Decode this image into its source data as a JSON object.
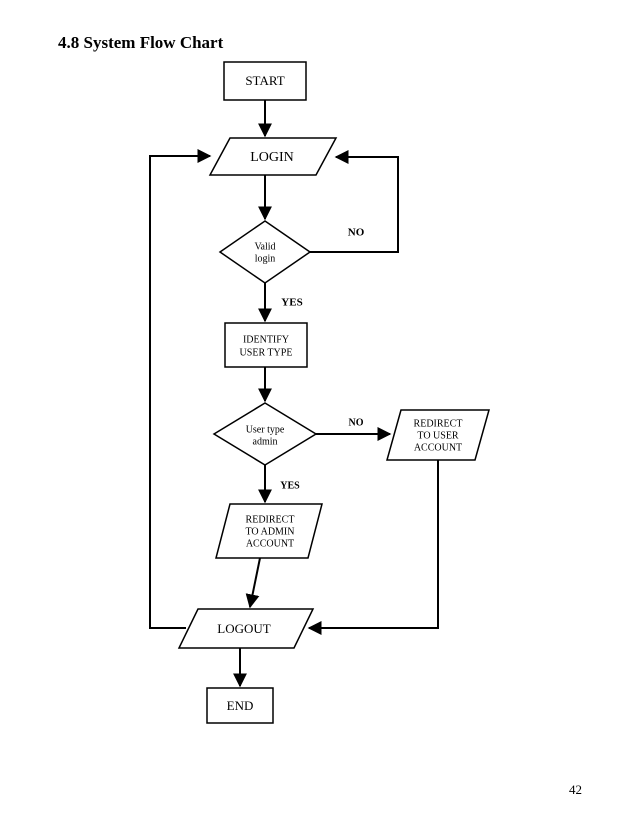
{
  "heading": "4.8 System Flow Chart",
  "page_number": "42",
  "nodes": {
    "start": "START",
    "login": "LOGIN",
    "valid_login_l1": "Valid",
    "valid_login_l2": "login",
    "identify_l1": "IDENTIFY",
    "identify_l2": "USER TYPE",
    "user_type_l1": "User type",
    "user_type_l2": "admin",
    "redirect_user_l1": "REDIRECT",
    "redirect_user_l2": "TO USER",
    "redirect_user_l3": "ACCOUNT",
    "redirect_admin_l1": "REDIRECT",
    "redirect_admin_l2": "TO ADMIN",
    "redirect_admin_l3": "ACCOUNT",
    "logout": "LOGOUT",
    "end": "END"
  },
  "edges": {
    "no1": "NO",
    "yes1": "YES",
    "no2": "NO",
    "yes2": "YES"
  },
  "chart_data": {
    "type": "flowchart",
    "title": "4.8 System Flow Chart",
    "nodes": [
      {
        "id": "start",
        "shape": "terminator",
        "label": "START"
      },
      {
        "id": "login",
        "shape": "io",
        "label": "LOGIN"
      },
      {
        "id": "valid_login",
        "shape": "decision",
        "label": "Valid login"
      },
      {
        "id": "identify",
        "shape": "process",
        "label": "IDENTIFY USER TYPE"
      },
      {
        "id": "user_type",
        "shape": "decision",
        "label": "User type admin"
      },
      {
        "id": "redirect_user",
        "shape": "io",
        "label": "REDIRECT TO USER ACCOUNT"
      },
      {
        "id": "redirect_admin",
        "shape": "io",
        "label": "REDIRECT TO ADMIN ACCOUNT"
      },
      {
        "id": "logout",
        "shape": "io",
        "label": "LOGOUT"
      },
      {
        "id": "end",
        "shape": "terminator",
        "label": "END"
      }
    ],
    "edges": [
      {
        "from": "start",
        "to": "login"
      },
      {
        "from": "login",
        "to": "valid_login"
      },
      {
        "from": "valid_login",
        "to": "identify",
        "label": "YES"
      },
      {
        "from": "valid_login",
        "to": "login",
        "label": "NO"
      },
      {
        "from": "identify",
        "to": "user_type"
      },
      {
        "from": "user_type",
        "to": "redirect_admin",
        "label": "YES"
      },
      {
        "from": "user_type",
        "to": "redirect_user",
        "label": "NO"
      },
      {
        "from": "redirect_admin",
        "to": "logout"
      },
      {
        "from": "redirect_user",
        "to": "logout"
      },
      {
        "from": "logout",
        "to": "end"
      },
      {
        "from": "logout",
        "to": "login"
      }
    ]
  }
}
